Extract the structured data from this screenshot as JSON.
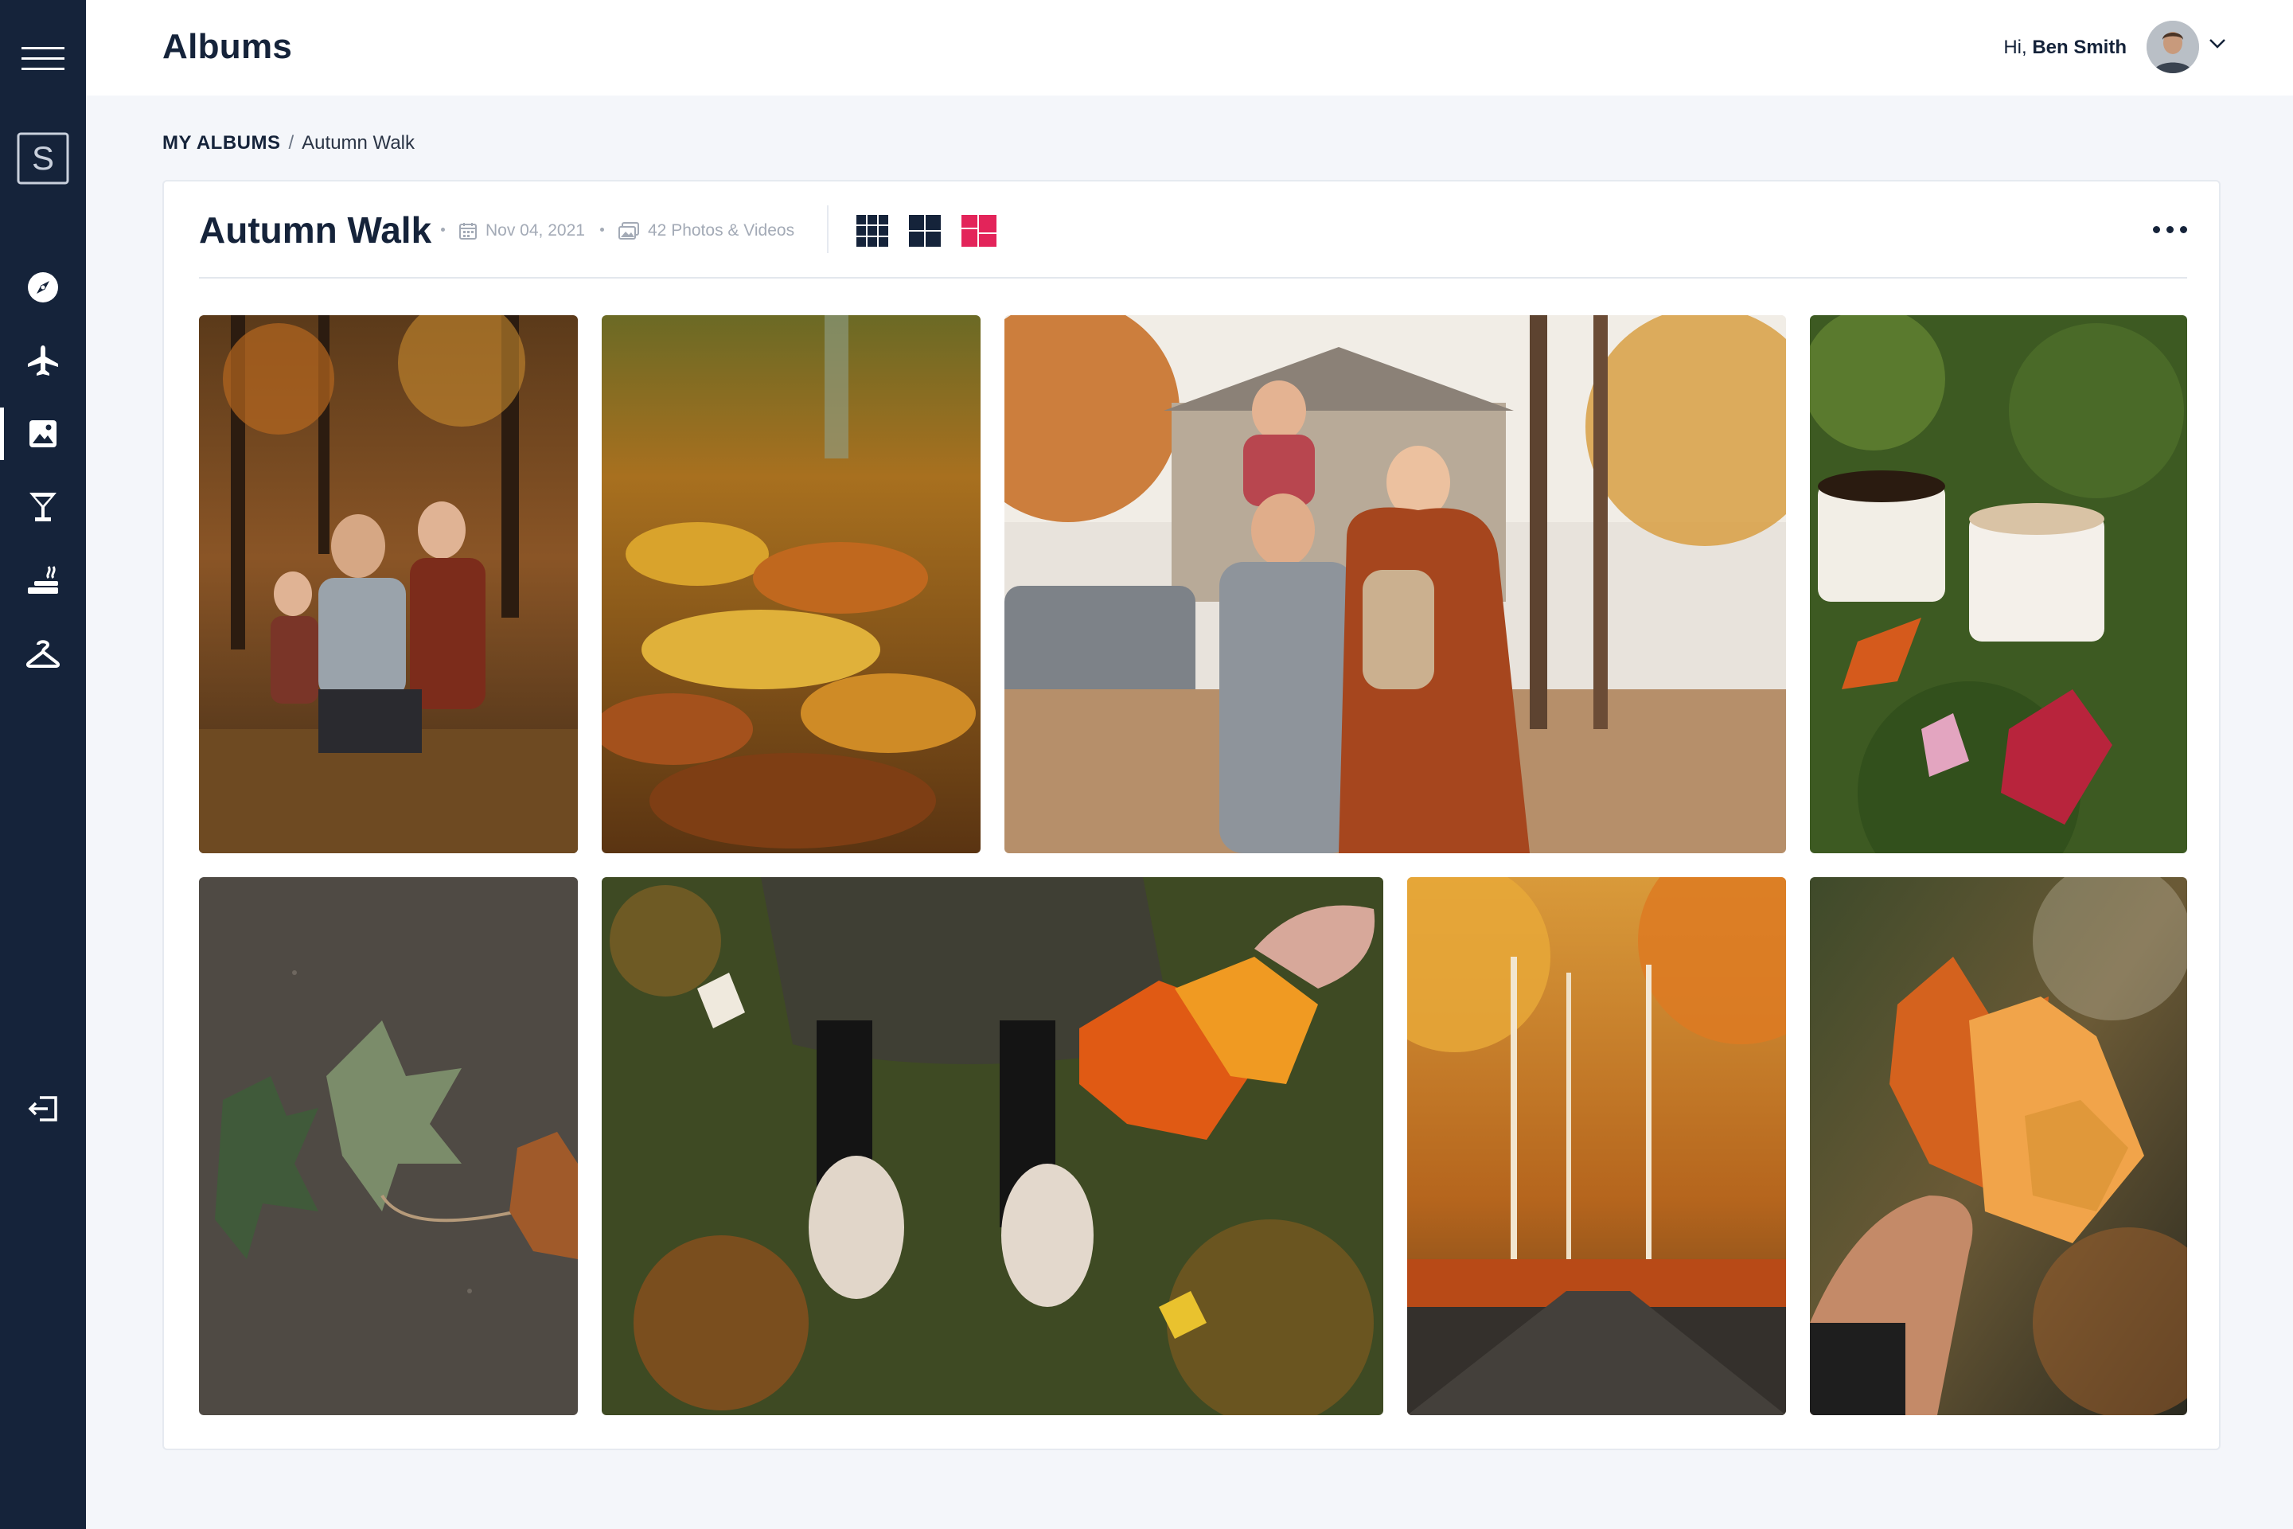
{
  "header": {
    "title": "Albums",
    "greeting_prefix": "Hi, ",
    "user_name": "Ben Smith"
  },
  "sidebar": {
    "logo_letter": "S",
    "items": [
      {
        "icon": "compass-icon"
      },
      {
        "icon": "airplane-icon"
      },
      {
        "icon": "image-icon",
        "active": true
      },
      {
        "icon": "cocktail-icon"
      },
      {
        "icon": "spa-icon"
      },
      {
        "icon": "hanger-icon"
      }
    ],
    "logout_icon": "logout-icon"
  },
  "breadcrumb": {
    "root": "MY ALBUMS",
    "separator": "/",
    "current": "Autumn Walk"
  },
  "album": {
    "title": "Autumn Walk",
    "date": "Nov 04, 2021",
    "count": "42 Photos & Videos",
    "view_modes": [
      "grid-3",
      "grid-2",
      "masonry"
    ],
    "active_view": "masonry",
    "accent": "#e3245a"
  },
  "photos": [
    {
      "subject": "family-in-forest"
    },
    {
      "subject": "fallen-leaves-closeup"
    },
    {
      "subject": "family-in-front-of-house"
    },
    {
      "subject": "enamel-mugs-on-leaves"
    },
    {
      "subject": "maple-leaves-on-ground"
    },
    {
      "subject": "feet-on-leaves-holding-leaf"
    },
    {
      "subject": "autumn-road-forest"
    },
    {
      "subject": "hand-holding-leaves"
    }
  ]
}
